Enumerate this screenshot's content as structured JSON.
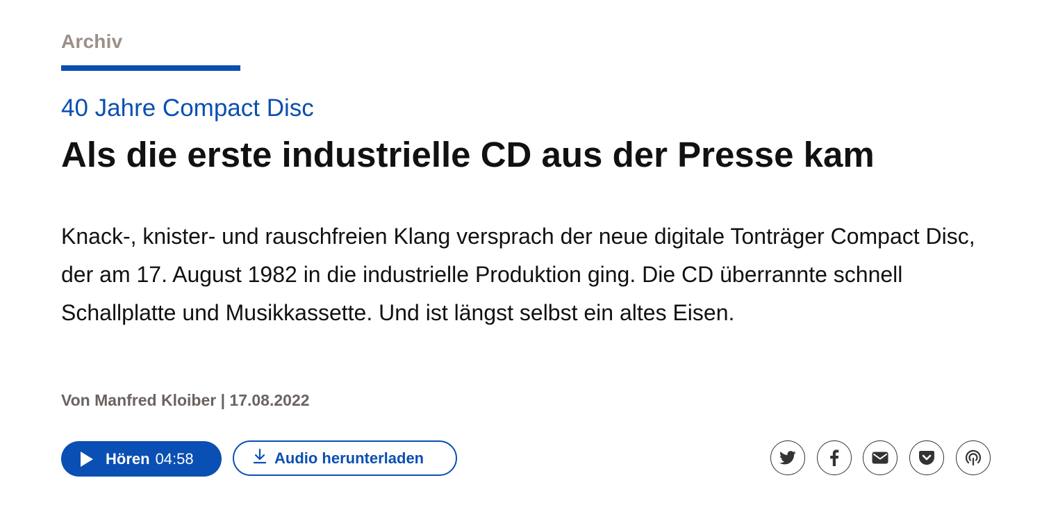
{
  "section": {
    "label": "Archiv"
  },
  "article": {
    "kicker": "40 Jahre Compact Disc",
    "headline": "Als die erste industrielle CD aus der Presse kam",
    "teaser": "Knack-, knister- und rauschfreien Klang versprach der neue digitale Tonträger Compact Disc, der am 17. August 1982 in die industrielle Produktion ging. Die CD überrannte schnell Schallplatte und Musikkassette. Und ist längst selbst ein altes Eisen.",
    "byline": "Von Manfred Kloiber | 17.08.2022"
  },
  "audio": {
    "play_label": "Hören",
    "duration": "04:58",
    "download_label": "Audio herunterladen"
  },
  "share": {
    "icons": [
      "twitter-icon",
      "facebook-icon",
      "mail-icon",
      "pocket-icon",
      "podcast-icon"
    ]
  },
  "colors": {
    "accent": "#0a4fb3",
    "section_label": "#9c8f88",
    "byline": "#6a6360",
    "text": "#111111"
  }
}
